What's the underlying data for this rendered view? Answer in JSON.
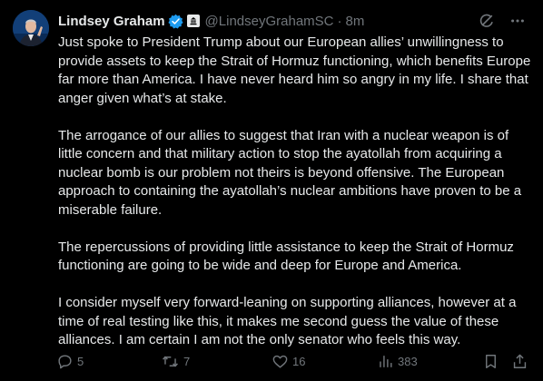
{
  "author": {
    "name": "Lindsey Graham",
    "handle": "@LindseyGrahamSC",
    "separator": "·",
    "time": "8m"
  },
  "tweet": {
    "paragraphs": [
      "Just spoke to President Trump about our European allies’ unwillingness to provide assets to keep the Strait of Hormuz functioning, which benefits Europe far more than America. I have never heard him so angry in my life. I share that anger given what’s at stake.",
      "The arrogance of our allies to suggest that Iran with a nuclear weapon is of little concern and that military action to stop the ayatollah from acquiring a nuclear bomb is our problem not theirs is beyond offensive. The European approach to containing the ayatollah’s nuclear ambitions have proven to be a miserable failure.",
      "The repercussions of providing little assistance to keep the Strait of Hormuz functioning are going to be wide and deep for Europe and America.",
      "I consider myself very forward-leaning on supporting alliances, however at a time of real testing like this, it makes me second guess the value of these alliances. I am certain I am not the only senator who feels this way."
    ]
  },
  "metrics": {
    "replies": "5",
    "reposts": "7",
    "likes": "16",
    "views": "383"
  },
  "icons": {
    "verified": "verified-badge-icon",
    "affiliation": "government-affiliation-icon",
    "grok": "grok-icon",
    "more": "more-icon",
    "reply": "reply-icon",
    "repost": "repost-icon",
    "like": "like-icon",
    "views": "views-icon",
    "bookmark": "bookmark-icon",
    "share": "share-icon"
  },
  "colors": {
    "background": "#000000",
    "text": "#e7e9ea",
    "secondary": "#71767b",
    "verified": "#1d9bf0"
  }
}
